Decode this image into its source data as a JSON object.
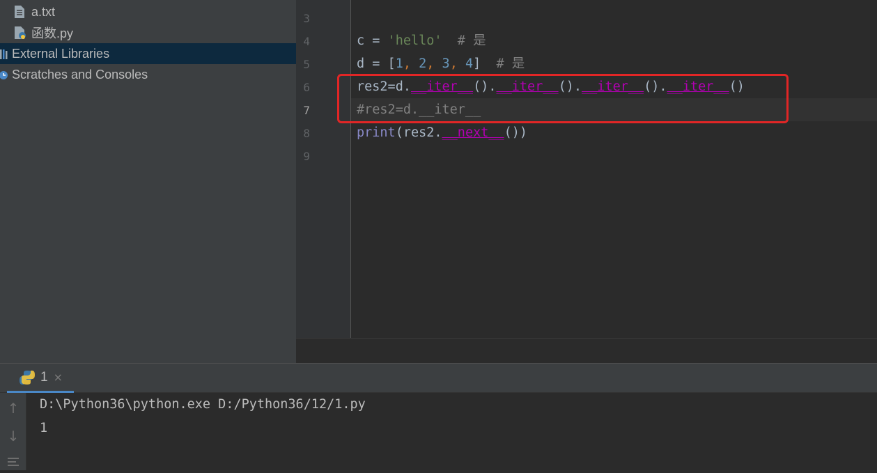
{
  "project_tree": {
    "items": [
      {
        "label": "a.txt",
        "icon": "text-file-icon"
      },
      {
        "label": "函数.py",
        "icon": "python-file-icon"
      },
      {
        "label": "External Libraries",
        "icon": "library-icon"
      },
      {
        "label": "Scratches and Consoles",
        "icon": "scratches-icon"
      }
    ]
  },
  "editor": {
    "line_numbers": [
      "3",
      "4",
      "5",
      "6",
      "7",
      "8",
      "9"
    ],
    "current_line": "7",
    "lines": {
      "l4": {
        "var": "c",
        "op": " = ",
        "str": "'hello'",
        "comment": "  # 是"
      },
      "l5": {
        "var": "d",
        "op": " = [",
        "n1": "1",
        "c1": ", ",
        "n2": "2",
        "c2": ", ",
        "n3": "3",
        "c3": ", ",
        "n4": "4",
        "close": "]",
        "comment": "  # 是"
      },
      "l6": {
        "prefix": "res2=d.",
        "d1": "__iter__",
        "p1": "().",
        "d2": "__iter__",
        "p2": "().",
        "d3": "__iter__",
        "p3": "().",
        "d4": "__iter__",
        "p4": "()"
      },
      "l7": {
        "comment": "#res2=d.__iter__"
      },
      "l8": {
        "builtin": "print",
        "open": "(res2.",
        "dunder": "__next__",
        "close": "())"
      }
    },
    "highlight_color": "#e12626"
  },
  "run_panel": {
    "tab_label": "1",
    "tab_close": "×",
    "console_lines": [
      "D:\\Python36\\python.exe D:/Python36/12/1.py",
      "1"
    ]
  }
}
